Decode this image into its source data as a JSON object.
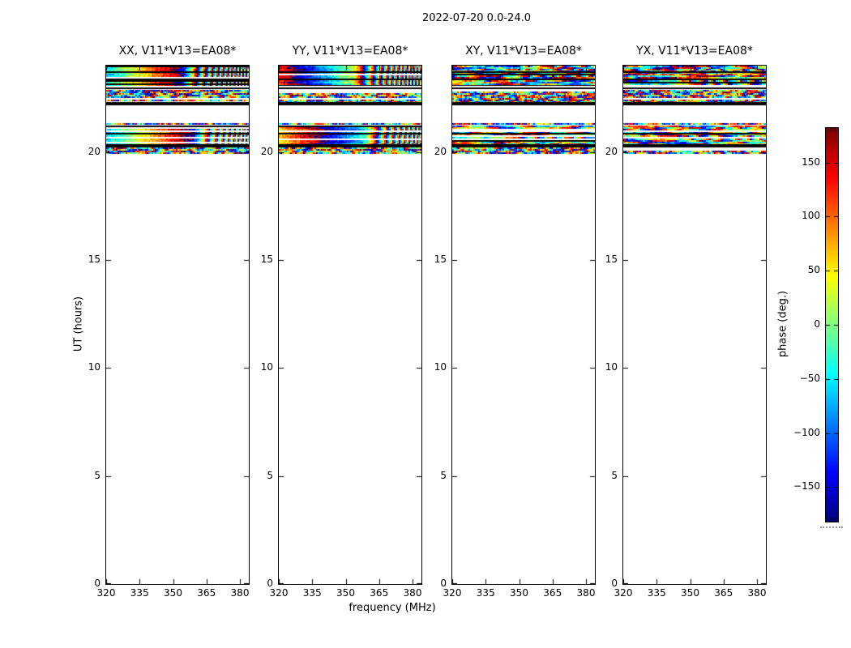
{
  "chart_data": {
    "type": "heatmap",
    "title": "2022-07-20 0.0-24.0",
    "xlabel": "frequency (MHz)",
    "ylabel": "UT (hours)",
    "xlim": [
      320,
      384
    ],
    "ylim": [
      0,
      24
    ],
    "x_ticks": [
      320,
      335,
      350,
      365,
      380
    ],
    "x_tick_labels": [
      "320",
      "335",
      "350",
      "365",
      "380"
    ],
    "y_ticks": [
      0,
      5,
      10,
      15,
      20
    ],
    "y_tick_labels": [
      "0",
      "5",
      "10",
      "15",
      "20"
    ],
    "grid": false,
    "panels": [
      {
        "label": "XX, V11*V13=EA08*",
        "polarization": "XX",
        "mode": "smooth",
        "phase_offsets": {
          "a": -60,
          "c": -75
        }
      },
      {
        "label": "YY, V11*V13=EA08*",
        "polarization": "YY",
        "mode": "smooth",
        "phase_offsets": {
          "a": 130,
          "c": 60
        }
      },
      {
        "label": "XY, V11*V13=EA08*",
        "polarization": "XY",
        "mode": "noise"
      },
      {
        "label": "YX, V11*V13=EA08*",
        "polarization": "YX",
        "mode": "noise"
      }
    ],
    "colorbar": {
      "label": "phase (deg.)",
      "colormap": "jet",
      "range": [
        -182,
        182
      ],
      "ticks": [
        150,
        100,
        50,
        0,
        -50,
        -100,
        -150
      ],
      "tick_labels": [
        "150",
        "100",
        "50",
        "0",
        "−50",
        "−100",
        "−150"
      ]
    },
    "observation": {
      "date": "2022-07-20",
      "ut_range_hours": [
        0.0,
        24.0
      ],
      "baseline": "V11*V13=EA08*",
      "data_present_ut_range": [
        19.9,
        24.0
      ]
    },
    "bands": [
      {
        "id": "a",
        "ut": [
          23.08,
          24.0
        ],
        "kind": "signal",
        "slope": 480,
        "chirp_start": 0.5,
        "chirp": 16000,
        "row_gap_chance": 0.08,
        "black_row_chance": 0.05
      },
      {
        "id": "a_line1",
        "ut": [
          23.67,
          23.73
        ],
        "kind": "black"
      },
      {
        "id": "a_line2",
        "ut": [
          23.34,
          23.39
        ],
        "kind": "black"
      },
      {
        "id": "a_sep",
        "ut": [
          22.92,
          22.99
        ],
        "kind": "black"
      },
      {
        "id": "b",
        "ut": [
          22.3,
          22.88
        ],
        "kind": "noise",
        "row_gap_chance": 0.12,
        "black_row_chance": 0.06
      },
      {
        "id": "b_sep",
        "ut": [
          22.17,
          22.3
        ],
        "kind": "black"
      },
      {
        "id": "c_pre",
        "ut": [
          21.26,
          21.35
        ],
        "kind": "noise",
        "row_gap_chance": 0.1,
        "black_row_chance": 0
      },
      {
        "id": "c",
        "ut": [
          20.37,
          21.24
        ],
        "kind": "signal",
        "slope": 430,
        "chirp_start": 0.58,
        "chirp": 16000,
        "row_gap_chance": 0.3,
        "black_row_chance": 0.04
      },
      {
        "id": "c_line",
        "ut": [
          20.8,
          20.89
        ],
        "kind": "black"
      },
      {
        "id": "c_sep",
        "ut": [
          20.22,
          20.37
        ],
        "kind": "black"
      },
      {
        "id": "d",
        "ut": [
          19.9,
          20.22
        ],
        "kind": "noise",
        "row_gap_chance": 0.3,
        "black_row_chance": 0.05
      }
    ]
  }
}
